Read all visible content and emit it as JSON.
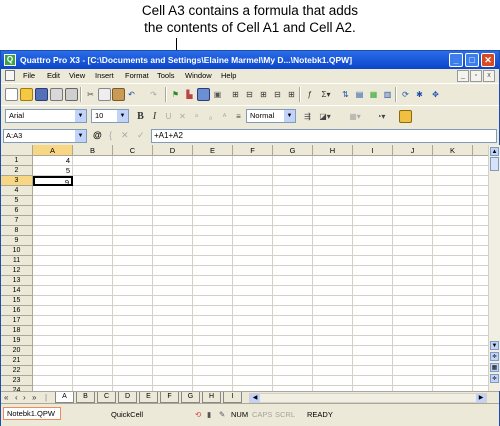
{
  "callout": {
    "line1": "Cell A3 contains a formula that adds",
    "line2": "the contents of Cell A1 and Cell A2."
  },
  "window": {
    "title": "Quattro Pro X3 - [C:\\Documents and Settings\\Elaine Marmel\\My D...\\Notebk1.QPW]",
    "controls": {
      "minimize": "_",
      "maximize": "□",
      "close": "✕"
    }
  },
  "menu": {
    "items": [
      "File",
      "Edit",
      "View",
      "Insert",
      "Format",
      "Tools",
      "Window",
      "Help"
    ],
    "doc_controls": {
      "minimize": "_",
      "restore": "▫",
      "close": "x"
    }
  },
  "toolbar2": {
    "font": "Arial",
    "size": "10",
    "bold": "B",
    "italic": "I",
    "style": "Normal"
  },
  "formula_bar": {
    "name_box": "A:A3",
    "at_icon": "@",
    "cancel_icon": "✕",
    "confirm_icon": "✓",
    "formula": "+A1+A2"
  },
  "grid": {
    "columns": [
      "A",
      "B",
      "C",
      "D",
      "E",
      "F",
      "G",
      "H",
      "I",
      "J",
      "K"
    ],
    "rows": [
      "1",
      "2",
      "3",
      "4",
      "5",
      "6",
      "7",
      "8",
      "9",
      "10",
      "11",
      "12",
      "13",
      "14",
      "15",
      "16",
      "17",
      "18",
      "19",
      "20",
      "21",
      "22",
      "23",
      "24"
    ],
    "selected_column": "A",
    "selected_row": "3",
    "cells": {
      "A1": "4",
      "A2": "5",
      "A3": "9"
    },
    "active_cell": "A3"
  },
  "sheet_tabs": {
    "nav": [
      "«",
      "‹",
      "›",
      "»",
      "|"
    ],
    "tabs": [
      "A",
      "B",
      "C",
      "D",
      "E",
      "F",
      "G",
      "H",
      "I"
    ],
    "active": "A"
  },
  "status": {
    "notebook": "Notebk1.QPW",
    "quickcell": "QuickCell",
    "num": "NUM",
    "caps": "CAPS",
    "scrl": "SCRL",
    "ready": "READY"
  },
  "colors": {
    "title_bar": "#0b45c9",
    "selection_header": "#f8d784",
    "chrome": "#ece9d8"
  }
}
